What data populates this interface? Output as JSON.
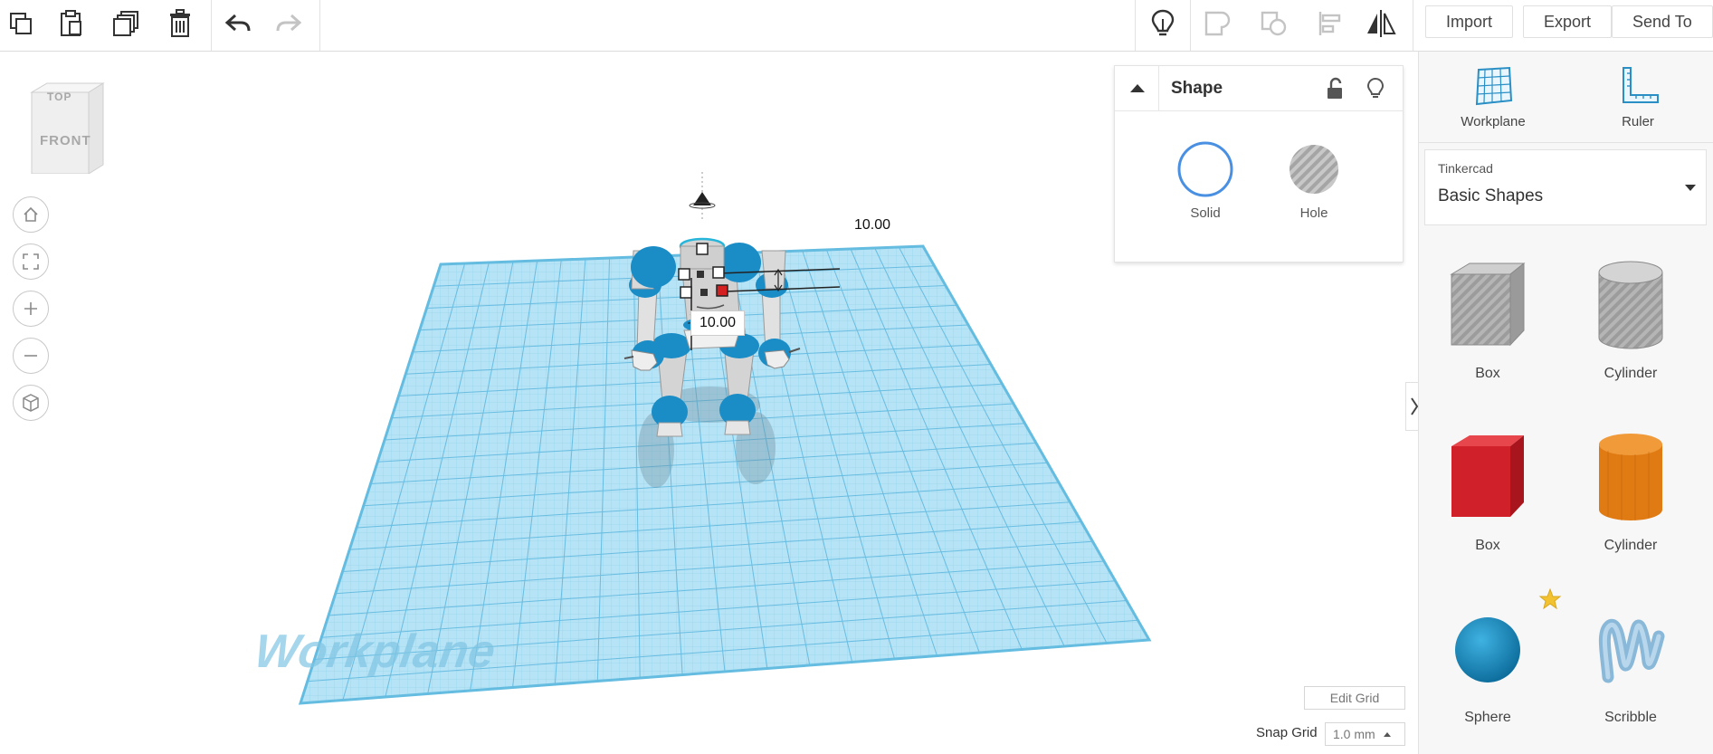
{
  "toolbar": {
    "left_icons": [
      "copy-icon",
      "paste-icon",
      "duplicate-icon",
      "delete-icon",
      "undo-icon",
      "redo-icon"
    ],
    "right_icons": [
      "lightbulb-icon",
      "group-icon",
      "ungroup-icon",
      "align-icon",
      "mirror-icon"
    ],
    "import_label": "Import",
    "export_label": "Export",
    "send_to_label": "Send To"
  },
  "viewcube": {
    "top_label": "TOP",
    "front_label": "FRONT"
  },
  "nav_icons": [
    "home-icon",
    "fit-view-icon",
    "zoom-in-icon",
    "zoom-out-icon",
    "perspective-icon"
  ],
  "dimensions": {
    "dim_a": "10.00",
    "dim_b": "10.00"
  },
  "workplane_watermark": "Workplane",
  "shape_panel": {
    "title": "Shape",
    "solid_label": "Solid",
    "hole_label": "Hole"
  },
  "grid": {
    "edit_grid_label": "Edit Grid",
    "snap_grid_label": "Snap Grid",
    "snap_value": "1.0 mm"
  },
  "sidebar": {
    "workplane_label": "Workplane",
    "ruler_label": "Ruler",
    "library_brand": "Tinkercad",
    "library_name": "Basic Shapes",
    "shapes": [
      {
        "label": "Box",
        "color": "#a9adb5"
      },
      {
        "label": "Cylinder",
        "color": "#b9bdc4"
      },
      {
        "label": "Box",
        "color": "#d0202a"
      },
      {
        "label": "Cylinder",
        "color": "#e07a12"
      },
      {
        "label": "Sphere",
        "color": "#1a8fc4"
      },
      {
        "label": "Scribble",
        "color": "#8ab8d8"
      }
    ]
  },
  "colors": {
    "workplane": "#aee1f5",
    "grid_line": "#6cc3e6",
    "accent": "#4a90e2",
    "robot_blue": "#1a8cc6",
    "robot_gray": "#d9d9d9"
  }
}
